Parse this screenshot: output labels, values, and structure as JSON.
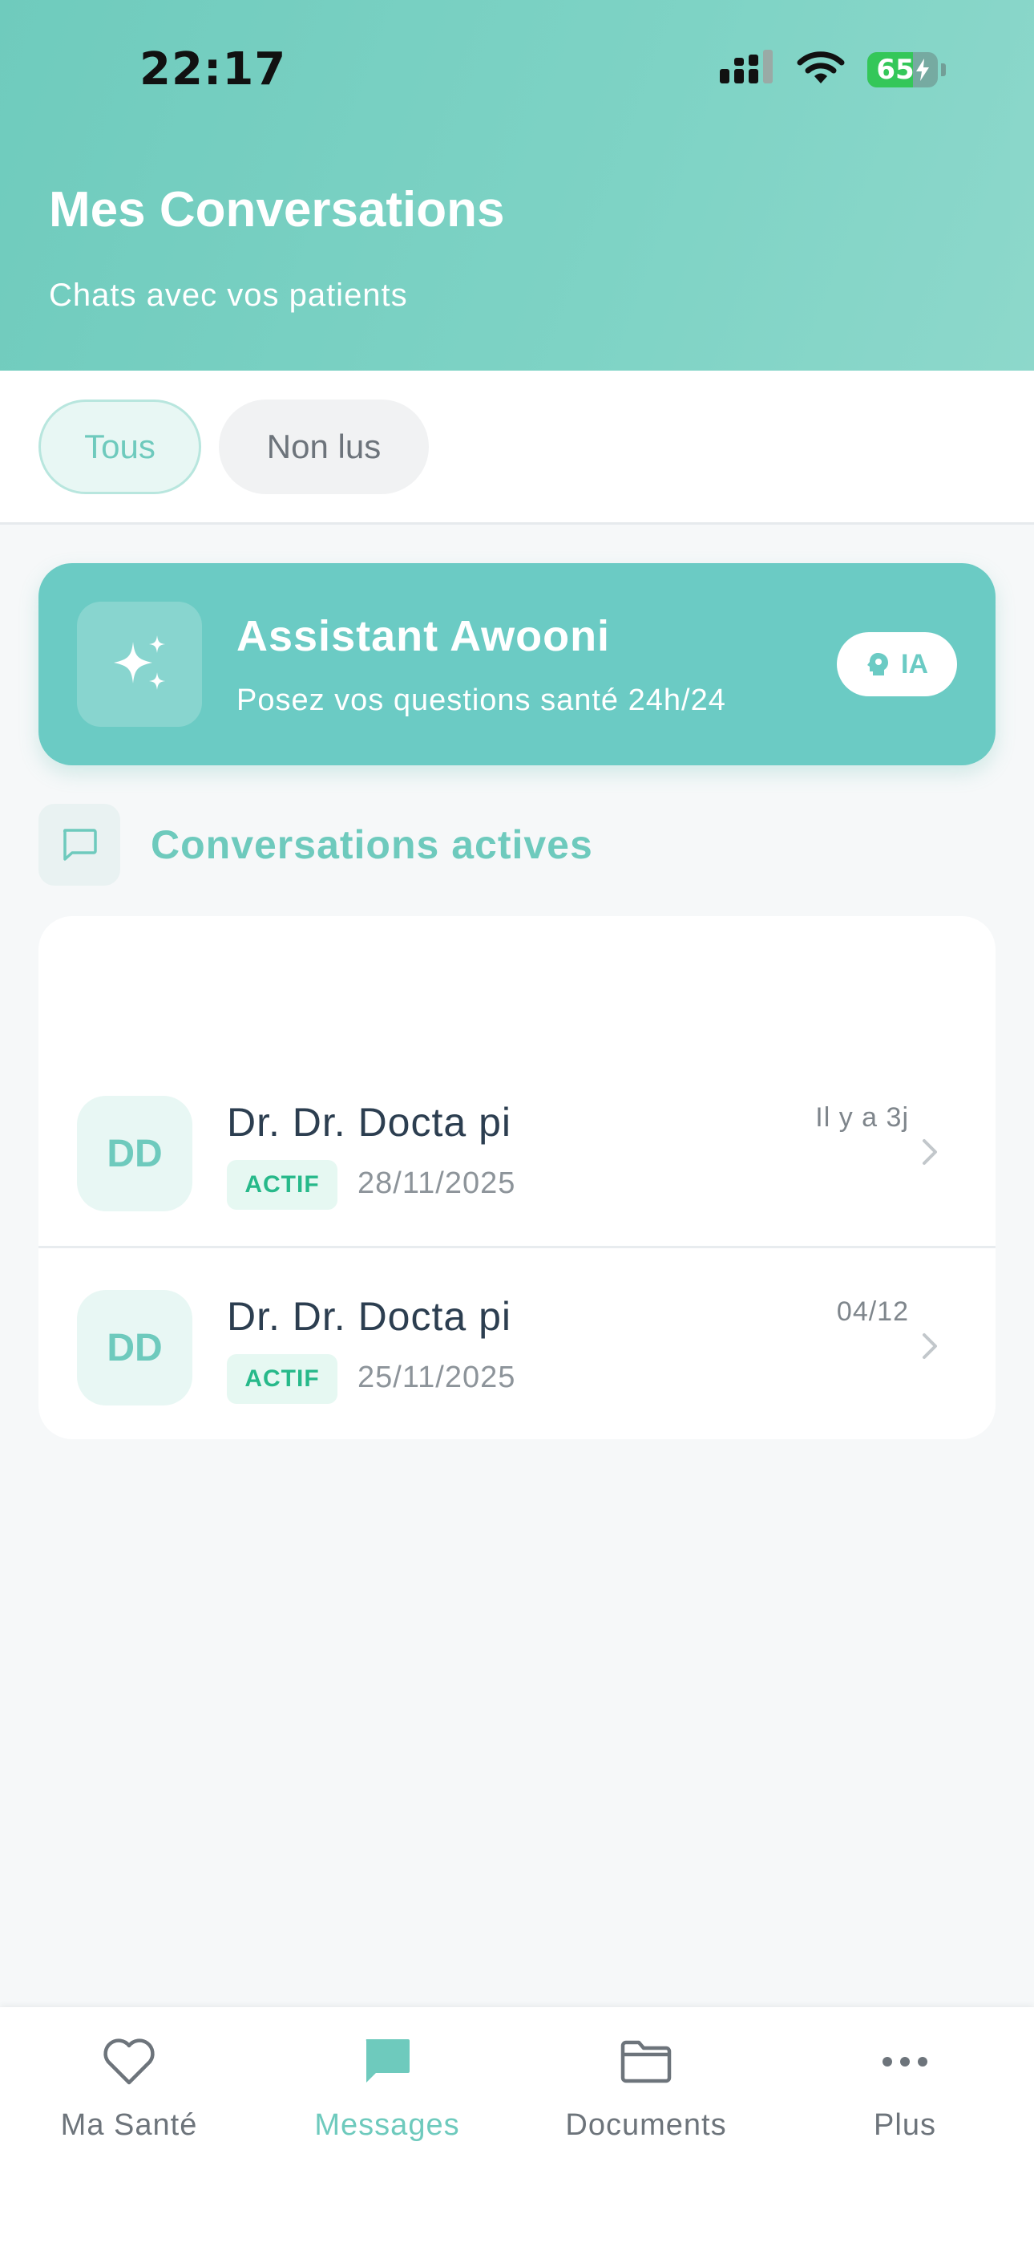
{
  "status_bar": {
    "time": "22:17",
    "battery_percent": "65",
    "battery_level": 0.65,
    "icons": [
      "cellular-signal-icon",
      "wifi-icon",
      "battery-charging-icon"
    ]
  },
  "header": {
    "title": "Mes Conversations",
    "subtitle": "Chats avec vos patients"
  },
  "filters": {
    "all_label": "Tous",
    "unread_label": "Non lus",
    "selected": "Tous"
  },
  "assistant": {
    "title": "Assistant Awooni",
    "subtitle": "Posez vos questions santé 24h/24",
    "badge": "IA",
    "icon": "sparkles-icon"
  },
  "section": {
    "title": "Conversations actives",
    "icon": "chat-bubble-icon"
  },
  "conversations": [
    {
      "initials": "DD",
      "name": "Dr. Dr. Docta pi",
      "time": "Il y a 3j",
      "status": "ACTIF",
      "date": "28/11/2025"
    },
    {
      "initials": "DD",
      "name": "Dr. Dr. Docta pi",
      "time": "04/12",
      "status": "ACTIF",
      "date": "25/11/2025"
    }
  ],
  "nav": {
    "items": [
      {
        "label": "Ma Santé",
        "icon": "heart-icon"
      },
      {
        "label": "Messages",
        "icon": "message-bubble-icon"
      },
      {
        "label": "Documents",
        "icon": "folder-icon"
      },
      {
        "label": "Plus",
        "icon": "more-dots-icon"
      }
    ],
    "active": "Messages"
  },
  "colors": {
    "accent": "#6ecabd",
    "header_gradient_start": "#6fcbbd",
    "assistant_card": "#6bcbc4",
    "status_active_text": "#27b98a",
    "status_active_bg": "#e6f8f2",
    "battery_green": "#34c759"
  }
}
